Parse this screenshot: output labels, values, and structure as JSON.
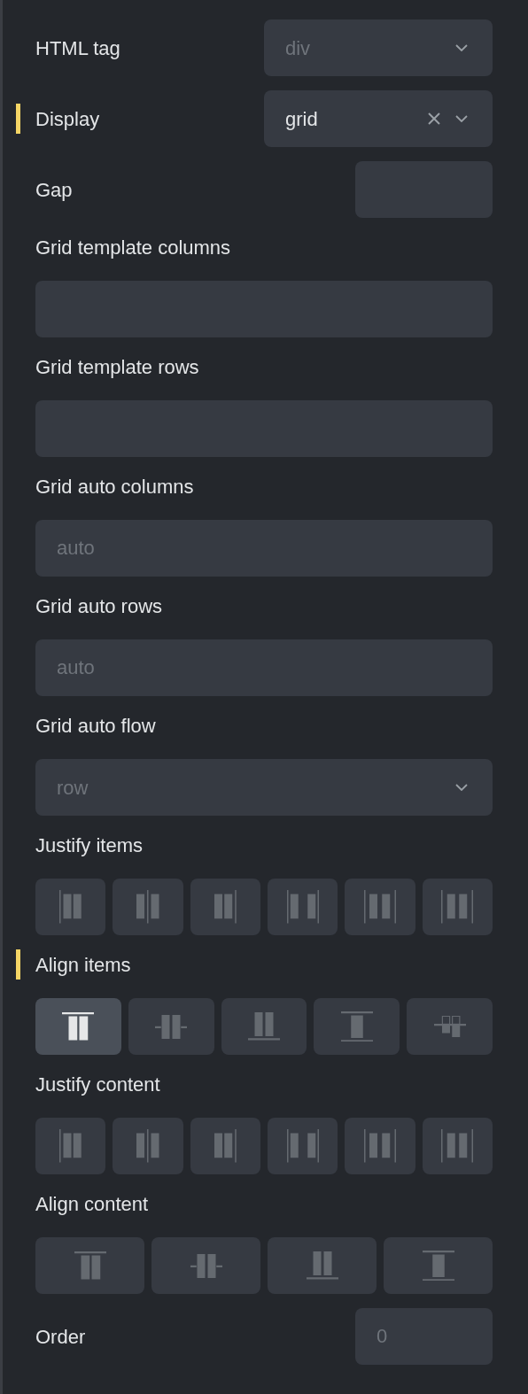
{
  "fields": [
    {
      "kind": "inline-select",
      "label": "HTML tag",
      "placeholder": "div",
      "clearable": false,
      "modified": false
    },
    {
      "kind": "inline-select",
      "label": "Display",
      "value": "grid",
      "clearable": true,
      "modified": true
    },
    {
      "kind": "inline-input",
      "label": "Gap",
      "modified": false
    },
    {
      "kind": "stacked-input",
      "label": "Grid template columns",
      "modified": false
    },
    {
      "kind": "stacked-input",
      "label": "Grid template rows",
      "modified": false
    },
    {
      "kind": "stacked-input",
      "label": "Grid auto columns",
      "placeholder": "auto",
      "modified": false
    },
    {
      "kind": "stacked-input",
      "label": "Grid auto rows",
      "placeholder": "auto",
      "modified": false
    },
    {
      "kind": "stacked-select",
      "label": "Grid auto flow",
      "placeholder": "row",
      "clearable": false,
      "modified": false
    },
    {
      "kind": "justify-buttons",
      "label": "Justify items",
      "modified": false,
      "options": [
        {
          "selected": false
        },
        {
          "selected": false
        },
        {
          "selected": false
        },
        {
          "selected": false
        },
        {
          "selected": false
        },
        {
          "selected": false
        }
      ]
    },
    {
      "kind": "align-buttons",
      "label": "Align items",
      "modified": true,
      "options": [
        {
          "selected": true
        },
        {
          "selected": false
        },
        {
          "selected": false
        },
        {
          "selected": false
        },
        {
          "selected": false
        }
      ]
    },
    {
      "kind": "justify-buttons",
      "label": "Justify content",
      "modified": false,
      "options": [
        {
          "selected": false
        },
        {
          "selected": false
        },
        {
          "selected": false
        },
        {
          "selected": false
        },
        {
          "selected": false
        },
        {
          "selected": false
        }
      ]
    },
    {
      "kind": "align-buttons",
      "label": "Align content",
      "modified": false,
      "options": [
        {
          "selected": false
        },
        {
          "selected": false
        },
        {
          "selected": false
        },
        {
          "selected": false
        }
      ]
    },
    {
      "kind": "inline-input",
      "label": "Order",
      "placeholder": "0",
      "modified": false
    }
  ]
}
